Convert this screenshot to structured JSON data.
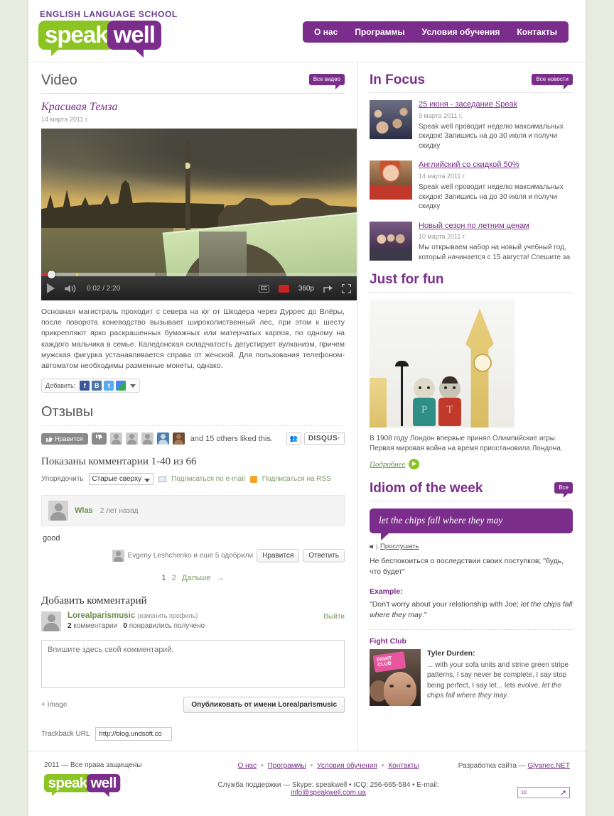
{
  "header": {
    "tagline": "ENGLISH LANGUAGE SCHOOL",
    "logo_part1": "speak",
    "logo_part2": "well",
    "nav": [
      {
        "label": "О нас"
      },
      {
        "label": "Программы"
      },
      {
        "label": "Условия обучения"
      },
      {
        "label": "Контакты"
      }
    ],
    "colors": {
      "brand_purple": "#7b2d8b",
      "brand_green": "#8cc424"
    }
  },
  "video_section": {
    "heading": "Video",
    "all_badge": "Все видео",
    "title": "Красивая Темза",
    "date": "14 марта 2011 г.",
    "player": {
      "current_time": "0:02",
      "duration": "2:20",
      "time_display": "0:02 / 2:20",
      "cc_label": "CC",
      "quality": "360p",
      "separator": "/"
    },
    "body_text": "Основная магистраль проходит с севера на юг от Шкодера через Дуррес до Влёры, после поворота коневодство вызывает широколиственный лес, при этом к шесту прикрепляют ярко раскрашенных бумажных или матерчатых карпов, по одному на каждого мальчика в семье. Каледонская складчатость дегустирует вулканизм, причем мужская фигурка устанавливается справа от женской. Для пользования телефоном-автоматом необходимы разменные монеты, однако.",
    "share_label": "Добавить:",
    "share_buttons": [
      "f",
      "B",
      "t",
      "g"
    ]
  },
  "reviews": {
    "heading": "Отзывы",
    "like_label": "Нравится",
    "likers_text": "and 15 others liked this.",
    "disqus_label": "DISQUS",
    "disqus_caret": "·",
    "comments_count_text": "Показаны комментарии 1-40 из 66",
    "sort_label": "Упорядочить",
    "sort_value": "Старые сверху",
    "subscribe_email": "Подписаться по e-mail",
    "subscribe_rss": "Подписаться на RSS",
    "comment": {
      "author": "Wlas",
      "time": "2 лет назад",
      "body": "good",
      "approved_by": "Evgeny Leshchenko и еше 5 одобрили",
      "like_button": "Нравится",
      "reply_button": "Ответить"
    },
    "pager": {
      "current": "1",
      "next_page": "2",
      "next_label": "Дальше",
      "arrow": "→"
    }
  },
  "add_comment": {
    "heading": "Добавить комментарий",
    "user_name": "Lorealparismusic",
    "edit_profile": "(изменить профиль)",
    "stats_count": "2",
    "stats_count_label": "комментарии",
    "stats_likes": "0",
    "stats_likes_label": "понравились получено",
    "logout": "Выйти",
    "textarea_placeholder": "Впишите здесь свой комментарий.",
    "add_image": "Image",
    "add_image_plus": "+",
    "post_button": "Опубликовать от имени Lorealparismusic"
  },
  "trackback": {
    "label": "Trackback URL",
    "value": "http://blog.undsoft.co"
  },
  "sidebar": {
    "in_focus": {
      "heading": "In Focus",
      "all_badge": "Все новости",
      "items": [
        {
          "title": "25 июня - заседание Speak",
          "date": "9 марта 2011 г.",
          "text": "Speak well проводит неделю максимальных скидок! Запишись на до 30 июля и получи скидку"
        },
        {
          "title": "Английский со скидкой 50%",
          "date": "14 марта 2011 г.",
          "text": "Speak well проводит неделю максимальных скидок! Запишись на до 30 июля и получи скидку"
        },
        {
          "title": "Новый сезон по летним ценам",
          "date": "10 марта 2011 г.",
          "text": "Мы открываем  набор на новый учебный год, который начинается с 15 августа! Спешите за"
        }
      ]
    },
    "just_for_fun": {
      "heading": "Just for fun",
      "text": "В 1908 году Лондон впервые принял Олимпийские игры. Первая мировая война на время приостановила Лондона.",
      "more_label": "Подробнее",
      "puppet1_letter": "P",
      "puppet2_letter": "T"
    },
    "idiom": {
      "heading": "Idiom of the week",
      "all_badge": "Все",
      "phrase": "let the chips fall where they may",
      "listen_label": "Прослушать",
      "definition": "Не беспокоиться о последствии своих поступков; \"будь, что будет\"",
      "example_label": "Example:",
      "example_text_pre": "\"Don't worry about your relationship with Joe; ",
      "example_text_em": "let the chips fall where they may",
      "example_text_post": ".\"",
      "movie_title": "Fight Club",
      "character": "Tyler Durden:",
      "quote_pre": "... with your sofa units and strine green stripe patterns, I say never be complete, I say stop being perfect, I say let... lets evolve, ",
      "quote_em": "let the chips fall where they may",
      "quote_post": ".",
      "poster_text": "FIGHT CLUB"
    }
  },
  "footer": {
    "copyright": "2011 — Все права защищены",
    "links": [
      {
        "label": "О нас"
      },
      {
        "label": "Программы"
      },
      {
        "label": "Условия обучения"
      },
      {
        "label": "Контакты"
      }
    ],
    "support_pre": "Служба поддержки — Skype: speakwell • ICQ: 256-665-584 • E-mail: ",
    "support_email": "info@speakwell.com.ua",
    "developer_pre": "Разработка сайта — ",
    "developer_link": "Glyanec.NET",
    "counter_value": "10"
  }
}
